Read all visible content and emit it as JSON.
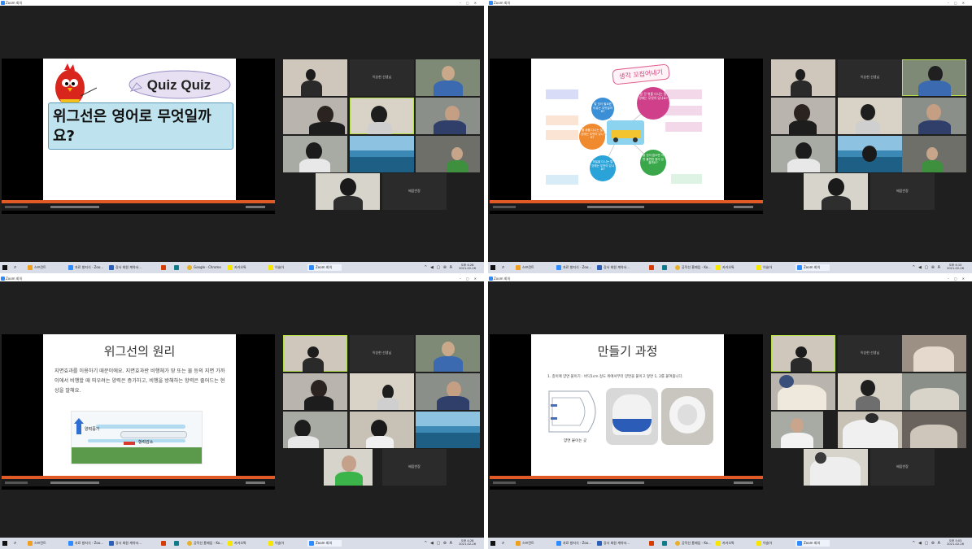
{
  "window_title": "Zoom 회의",
  "taskbar": {
    "items": [
      {
        "label": "스프린트",
        "color": "#f0a020"
      },
      {
        "label": "자료 발지식 - Zoo...",
        "color": "#2d8cff"
      },
      {
        "label": "강사 회원 계약서...",
        "color": "#2b5fb8"
      },
      {
        "label": "",
        "color": "#d83b01"
      },
      {
        "label": "",
        "color": "#0e7a8a"
      },
      {
        "label": "Google - Chrome",
        "color": "#e7b02a"
      },
      {
        "label": "카카오톡",
        "color": "#f7e600"
      },
      {
        "label": "이슬아",
        "color": "#f7e600"
      },
      {
        "label": "Zoom 회의",
        "color": "#2d8cff"
      }
    ],
    "items_alt": [
      {
        "label": "스프린트",
        "color": "#f0a020"
      },
      {
        "label": "자료 발지식 - Zoo...",
        "color": "#2d8cff"
      },
      {
        "label": "강사 회원 계약서...",
        "color": "#2b5fb8"
      },
      {
        "label": "",
        "color": "#d83b01"
      },
      {
        "label": "",
        "color": "#0e7a8a"
      },
      {
        "label": "공작선 홈페임 - Ko...",
        "color": "#e7b02a"
      },
      {
        "label": "카카오톡",
        "color": "#f7e600"
      },
      {
        "label": "이슬아",
        "color": "#f7e600"
      },
      {
        "label": "Zoom 회의",
        "color": "#2d8cff"
      }
    ],
    "tray": "^ ◀ ▢ ⊕ A",
    "quad_clock": [
      {
        "time": "오후 4:28",
        "date": "2021-02-26"
      },
      {
        "time": "오후 4:15",
        "date": "2021-02-26"
      },
      {
        "time": "오후 4:28",
        "date": "2021-02-26"
      },
      {
        "time": "오후 5:03",
        "date": "2021-02-26"
      }
    ]
  },
  "gallery_name": "이승현 선생님",
  "gallery_name_alt": "배움반장",
  "slide1": {
    "badge": "Quiz Quiz",
    "question": "위그선은 영어로 무엇일까요?"
  },
  "slide2": {
    "title": "생각 꼬집어내기",
    "bubbles": [
      "탈 것 위를 다니는 탈 것에는 무엇이 있나요?",
      "물 위를 다니는 탈 것에는 무엇이 있나요?",
      "하늘을 다니는 탈 것에는 무엇이 있나요?",
      "탈 것이 없으면 어떤 불편한 점이 있을까요?",
      "탈 것이 필요한 이유는 무엇일까요?"
    ]
  },
  "slide3": {
    "title": "위그선의 원리",
    "body": "지면효과를 이용하기 때문이에요. 지면효과란 비행체가 땅 또는 물 등의 지면 가까이에서 비행할 때 띄우려는 양력은 증가하고, 비행을 방해하는 항력은 줄어드는 현상을 말해요.",
    "label_up": "양력증가",
    "label_drag": "항력감소"
  },
  "slide4": {
    "title": "만들기 과정",
    "step": "1. 종이에 양면 붙이기 : 바닥1cm 정도 위에서부터 양면을 붙이고 앞면 1, 2를 붙여줍니다.",
    "caption": "양면 붙이는 곳"
  }
}
